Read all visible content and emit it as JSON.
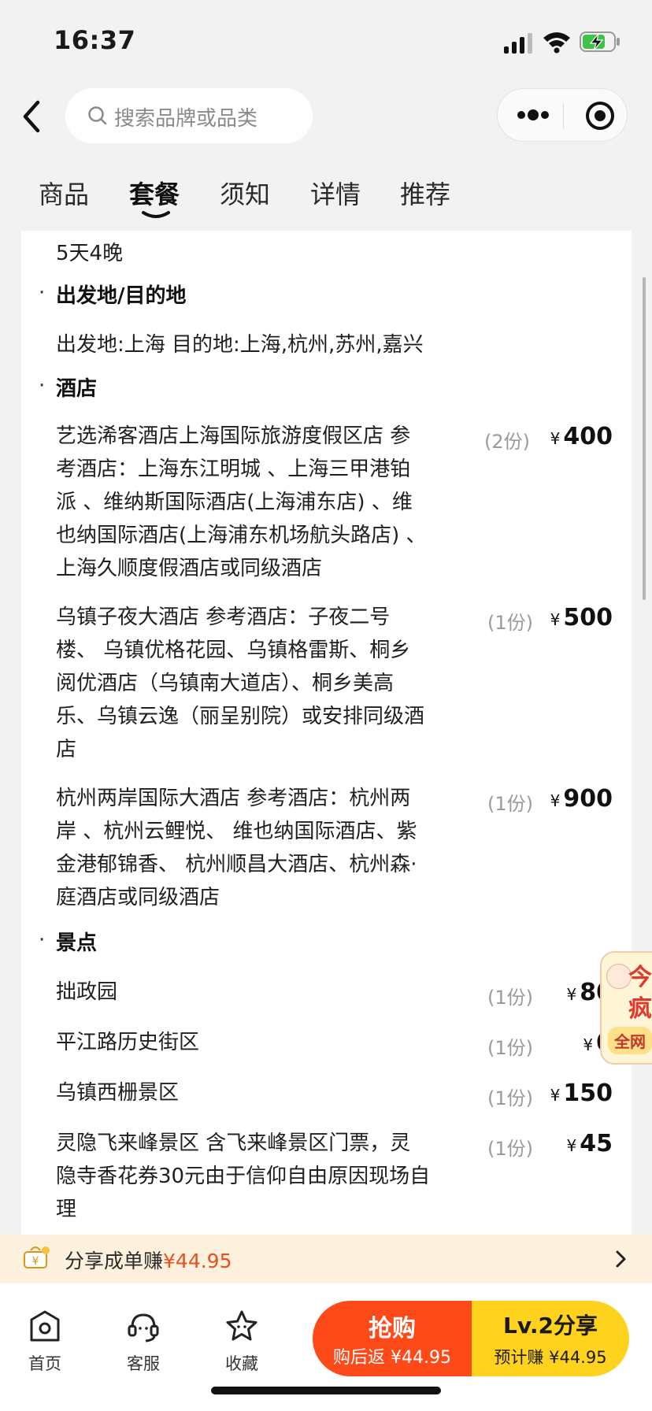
{
  "status_bar": {
    "time": "16:37"
  },
  "search": {
    "placeholder": "搜索品牌或品类"
  },
  "tabs": [
    {
      "label": "商品",
      "active": false
    },
    {
      "label": "套餐",
      "active": true
    },
    {
      "label": "须知",
      "active": false
    },
    {
      "label": "详情",
      "active": false
    },
    {
      "label": "推荐",
      "active": false
    }
  ],
  "content": {
    "duration": "5天4晚",
    "departure_section": {
      "title": "出发地/目的地",
      "text": "出发地:上海 目的地:上海,杭州,苏州,嘉兴"
    },
    "hotel_section": {
      "title": "酒店",
      "items": [
        {
          "lines": [
            "艺选浠客酒店上海国际旅游度假区店 参",
            "考酒店：上海东江明城 、上海三甲港铂",
            "派 、维纳斯国际酒店(上海浦东店) 、维",
            "也纳国际酒店(上海浦东机场航头路店) 、",
            "上海久顺度假酒店或同级酒店"
          ],
          "qty": "(2份)",
          "currency": "¥",
          "price": "400"
        },
        {
          "lines": [
            "乌镇子夜大酒店 参考酒店：子夜二号",
            "楼、 乌镇优格花园、乌镇格雷斯、桐乡",
            "阅优酒店（乌镇南大道店）、桐乡美高",
            "乐、乌镇云逸（丽呈别院）或安排同级酒",
            "店"
          ],
          "qty": "(1份)",
          "currency": "¥",
          "price": "500"
        },
        {
          "lines": [
            "杭州两岸国际大酒店 参考酒店：杭州两",
            "岸 、杭州云鲤悦、 维也纳国际酒店、紫",
            "金港郁锦香、 杭州顺昌大酒店、杭州森·",
            "庭酒店或同级酒店"
          ],
          "qty": "(1份)",
          "currency": "¥",
          "price": "900"
        }
      ]
    },
    "scenic_section": {
      "title": "景点",
      "items": [
        {
          "lines": [
            "拙政园"
          ],
          "qty": "(1份)",
          "currency": "¥",
          "price": "80"
        },
        {
          "lines": [
            "平江路历史街区"
          ],
          "qty": "(1份)",
          "currency": "¥",
          "price": "0"
        },
        {
          "lines": [
            "乌镇西栅景区"
          ],
          "qty": "(1份)",
          "currency": "¥",
          "price": "150"
        },
        {
          "lines": [
            "灵隐飞来峰景区 含飞来峰景区门票，灵",
            "隐寺香花券30元由于信仰自由原因现场自",
            "理"
          ],
          "qty": "(1份)",
          "currency": "¥",
          "price": "45"
        }
      ]
    }
  },
  "float_badge": {
    "line1": "今",
    "line2": "疯",
    "line3": "全网"
  },
  "share_bar": {
    "text": "分享成单赚",
    "amount": "¥44.95"
  },
  "bottom_nav": [
    {
      "label": "首页",
      "icon": "home-icon"
    },
    {
      "label": "客服",
      "icon": "customer-service-icon"
    },
    {
      "label": "收藏",
      "icon": "favorite-star-icon"
    }
  ],
  "buy_button": {
    "label": "抢购",
    "sub": "购后返 ¥44.95"
  },
  "share_button": {
    "label": "Lv.2分享",
    "sub": "预计赚 ¥44.95"
  },
  "colors": {
    "buy": "#fe4a18",
    "share": "#ffd21e",
    "share_bar_bg": "#fdf1de",
    "accent_orange": "#e8501e"
  }
}
